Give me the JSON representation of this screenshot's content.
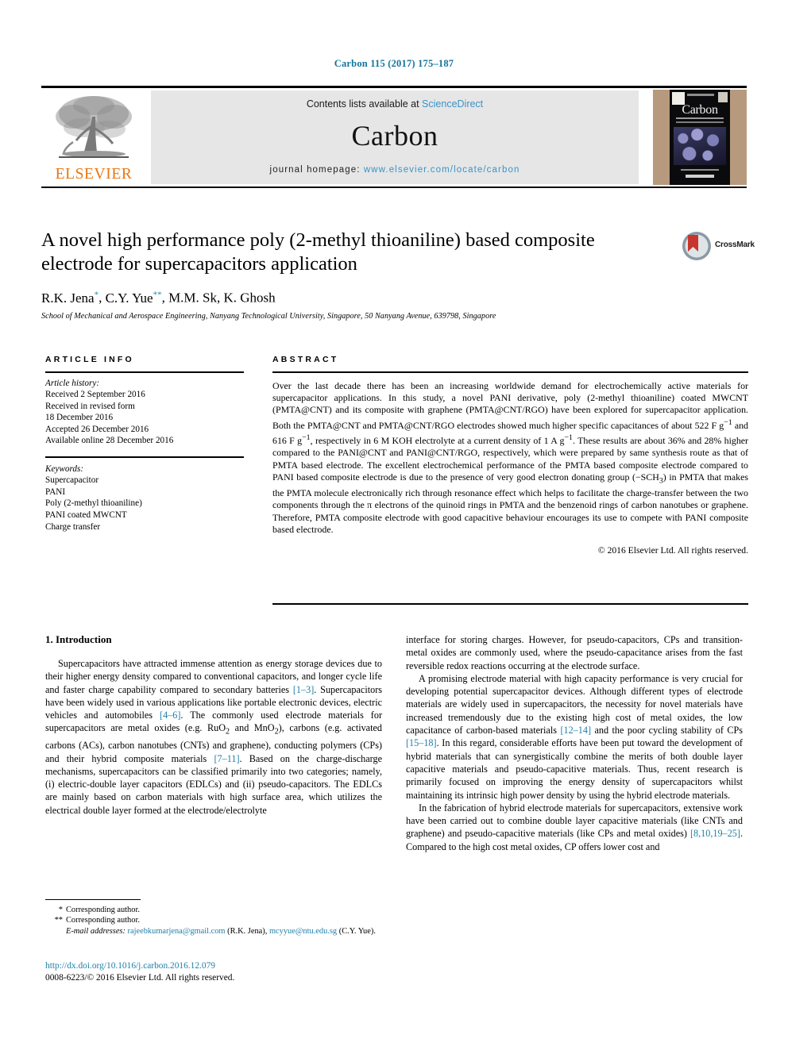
{
  "running_head": "Carbon 115 (2017) 175–187",
  "colors": {
    "link": "#1f7fa8",
    "header_blue": "#15749b",
    "elsevier_orange": "#e87511",
    "banner_bg": "#e6e6e6",
    "sciencedirect_blue": "#3a93c8"
  },
  "masthead": {
    "publisher_logo_name": "ELSEVIER",
    "contents_prefix": "Contents lists available at ",
    "contents_link": "ScienceDirect",
    "journal_title": "Carbon",
    "homepage_prefix": "journal homepage: ",
    "homepage_url": "www.elsevier.com/locate/carbon",
    "cover_title": "Carbon"
  },
  "article": {
    "title": "A novel high performance poly (2-methyl thioaniline) based composite electrode for supercapacitors application",
    "authors_parts": [
      {
        "name": "R.K. Jena",
        "mark": "*"
      },
      {
        "name": "C.Y. Yue",
        "mark": "**"
      },
      {
        "name": "M.M. Sk",
        "mark": ""
      },
      {
        "name": "K. Ghosh",
        "mark": ""
      }
    ],
    "affiliation": "School of Mechanical and Aerospace Engineering, Nanyang Technological University, Singapore, 50 Nanyang Avenue, 639798, Singapore",
    "crossmark_label": "CrossMark"
  },
  "article_info": {
    "heading": "ARTICLE INFO",
    "history_label": "Article history:",
    "history": [
      "Received 2 September 2016",
      "Received in revised form",
      "18 December 2016",
      "Accepted 26 December 2016",
      "Available online 28 December 2016"
    ],
    "keywords_label": "Keywords:",
    "keywords": [
      "Supercapacitor",
      "PANI",
      "Poly (2-methyl thioaniline)",
      "PANI coated MWCNT",
      "Charge transfer"
    ]
  },
  "abstract": {
    "heading": "ABSTRACT",
    "text": "Over the last decade there has been an increasing worldwide demand for electrochemically active materials for supercapacitor applications. In this study, a novel PANI derivative, poly (2-methyl thioaniline) coated MWCNT (PMTA@CNT) and its composite with graphene (PMTA@CNT/RGO) have been explored for supercapacitor application. Both the PMTA@CNT and PMTA@CNT/RGO electrodes showed much higher specific capacitances of about 522 F g−1 and 616 F g−1, respectively in 6 M KOH electrolyte at a current density of 1 A g−1. These results are about 36% and 28% higher compared to the PANI@CNT and PANI@CNT/RGO, respectively, which were prepared by same synthesis route as that of PMTA based electrode. The excellent electrochemical performance of the PMTA based composite electrode compared to PANI based composite electrode is due to the presence of very good electron donating group (−SCH3) in PMTA that makes the PMTA molecule electronically rich through resonance effect which helps to facilitate the charge-transfer between the two components through the π electrons of the quinoid rings in PMTA and the benzenoid rings of carbon nanotubes or graphene. Therefore, PMTA composite electrode with good capacitive behaviour encourages its use to compete with PANI composite based electrode.",
    "copyright": "© 2016 Elsevier Ltd. All rights reserved."
  },
  "body": {
    "section_number_title": "1. Introduction",
    "left_paragraphs": [
      "Supercapacitors have attracted immense attention as energy storage devices due to their higher energy density compared to conventional capacitors, and longer cycle life and faster charge capability compared to secondary batteries [1–3]. Supercapacitors have been widely used in various applications like portable electronic devices, electric vehicles and automobiles [4–6]. The commonly used electrode materials for supercapacitors are metal oxides (e.g. RuO2 and MnO2), carbons (e.g. activated carbons (ACs), carbon nanotubes (CNTs) and graphene), conducting polymers (CPs) and their hybrid composite materials [7–11]. Based on the charge-discharge mechanisms, supercapacitors can be classified primarily into two categories; namely, (i) electric-double layer capacitors (EDLCs) and (ii) pseudo-capacitors. The EDLCs are mainly based on carbon materials with high surface area, which utilizes the electrical double layer formed at the electrode/electrolyte"
    ],
    "right_paragraphs": [
      "interface for storing charges. However, for pseudo-capacitors, CPs and transition-metal oxides are commonly used, where the pseudo-capacitance arises from the fast reversible redox reactions occurring at the electrode surface.",
      "A promising electrode material with high capacity performance is very crucial for developing potential supercapacitor devices. Although different types of electrode materials are widely used in supercapacitors, the necessity for novel materials have increased tremendously due to the existing high cost of metal oxides, the low capacitance of carbon-based materials [12–14] and the poor cycling stability of CPs [15–18]. In this regard, considerable efforts have been put toward the development of hybrid materials that can synergistically combine the merits of both double layer capacitive materials and pseudo-capacitive materials. Thus, recent research is primarily focused on improving the energy density of supercapacitors whilst maintaining its intrinsic high power density by using the hybrid electrode materials.",
      "In the fabrication of hybrid electrode materials for supercapacitors, extensive work have been carried out to combine double layer capacitive materials (like CNTs and graphene) and pseudo-capacitive materials (like CPs and metal oxides) [8,10,19–25]. Compared to the high cost metal oxides, CP offers lower cost and"
    ]
  },
  "footnotes": {
    "corresponding_1_mark": "*",
    "corresponding_1": "Corresponding author.",
    "corresponding_2_mark": "**",
    "corresponding_2": "Corresponding author.",
    "email_label": "E-mail addresses:",
    "email_1": "rajeebkumarjena@gmail.com",
    "email_1_owner": "(R.K. Jena),",
    "email_2": "mcyyue@ntu.edu.sg",
    "email_2_owner": "(C.Y. Yue)."
  },
  "footer": {
    "doi": "http://dx.doi.org/10.1016/j.carbon.2016.12.079",
    "issn_line": "0008-6223/© 2016 Elsevier Ltd. All rights reserved."
  }
}
